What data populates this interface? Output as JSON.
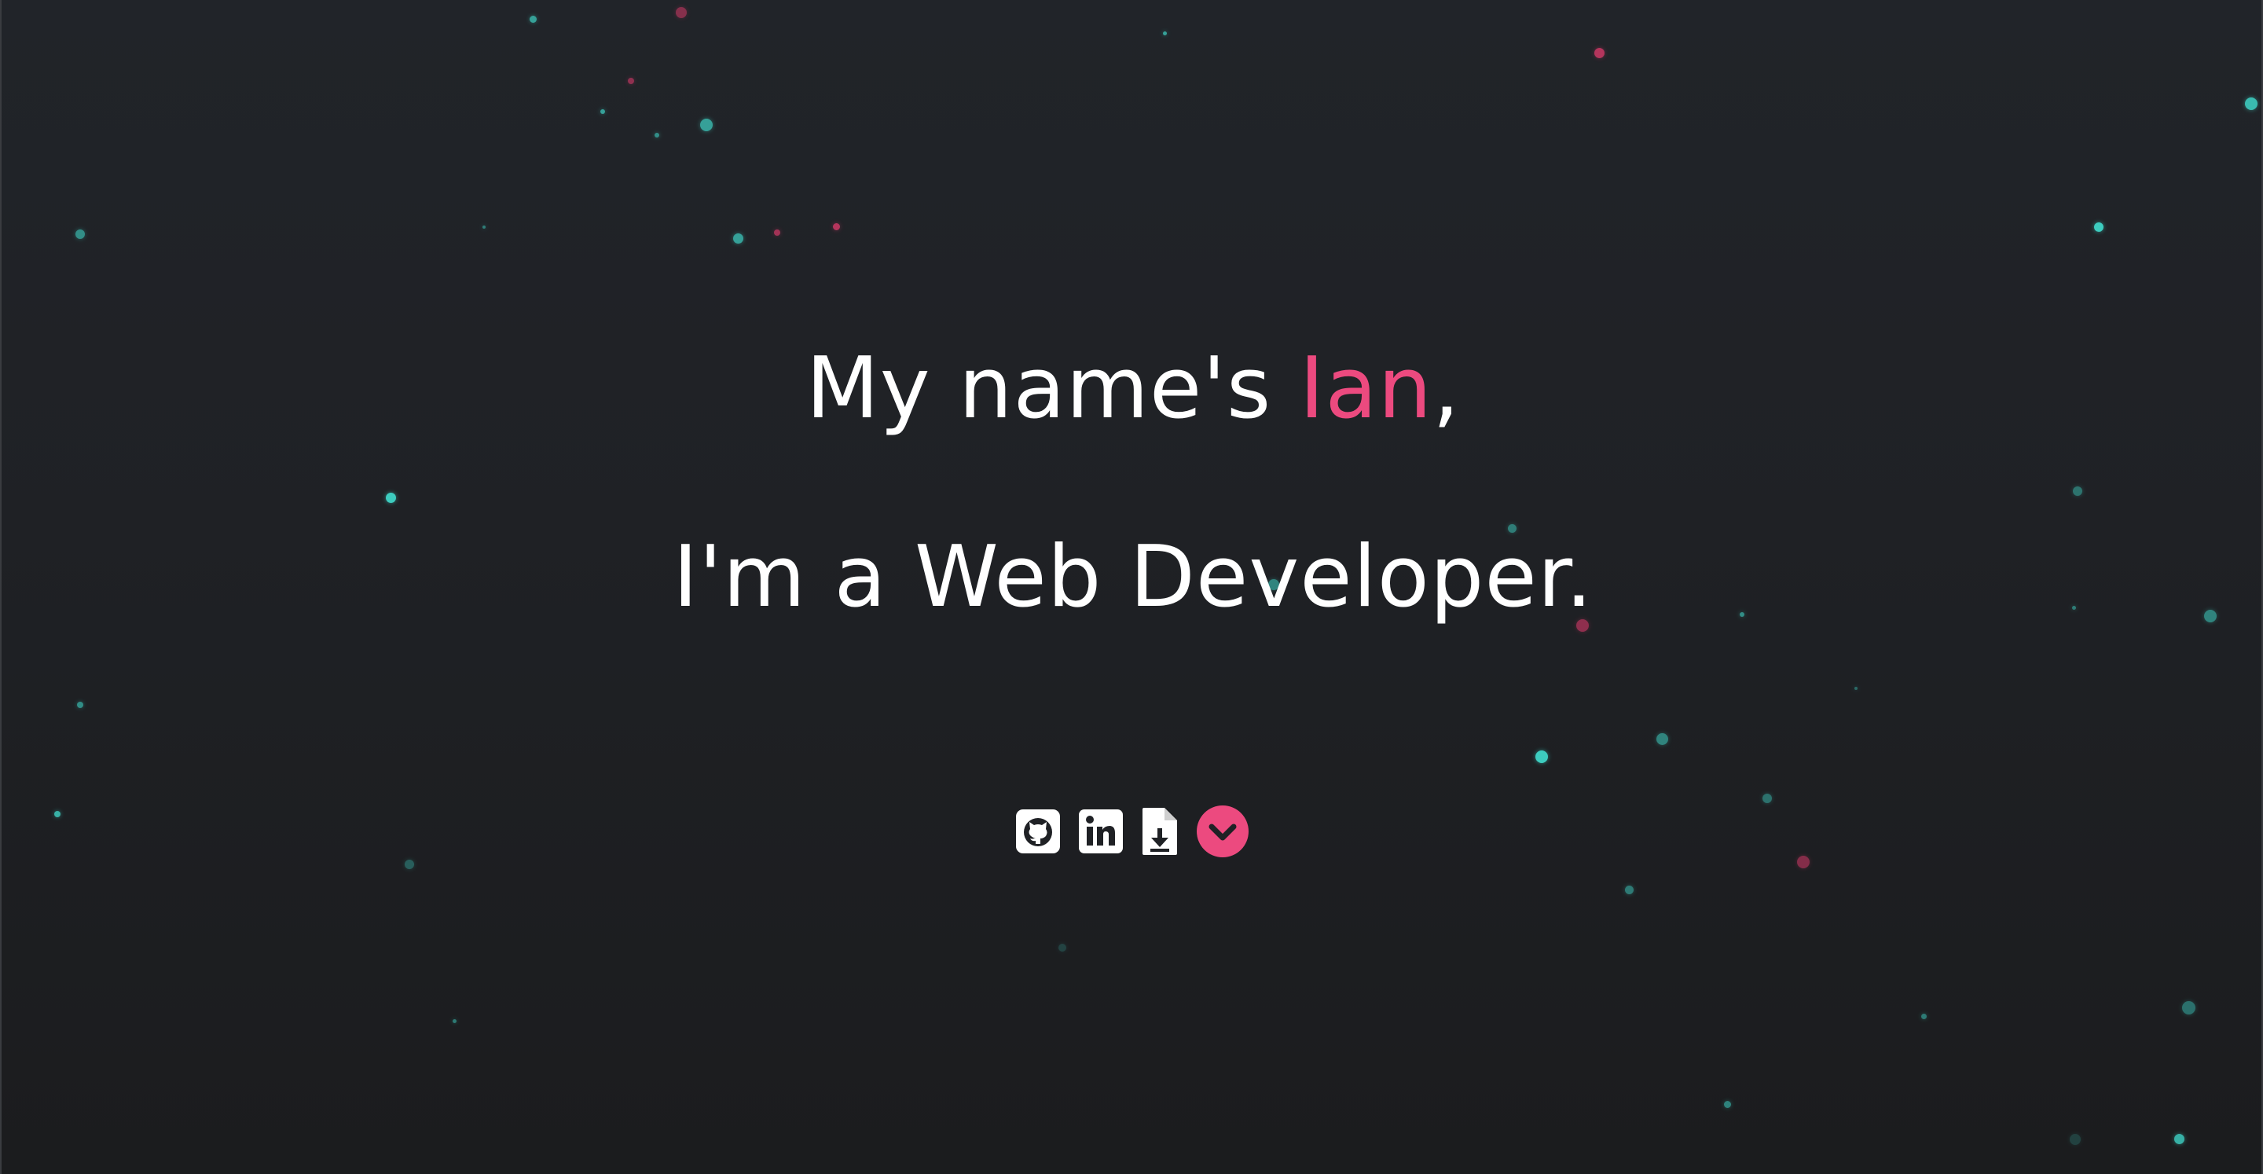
{
  "hero": {
    "line1_prefix": "My name's ",
    "line1_name": "Ian",
    "line1_suffix": ",",
    "line2": "I'm a Web Developer."
  },
  "icons": [
    {
      "name": "github-icon",
      "label": "GitHub"
    },
    {
      "name": "linkedin-icon",
      "label": "LinkedIn"
    },
    {
      "name": "resume-download-icon",
      "label": "Resume"
    },
    {
      "name": "scroll-down-icon",
      "label": "Scroll down"
    }
  ],
  "colors": {
    "background": "#1f2125",
    "text": "#ffffff",
    "accent": "#ec4a7f",
    "particle_teal": "#3fd6c8",
    "particle_pink": "#d93a6a"
  }
}
